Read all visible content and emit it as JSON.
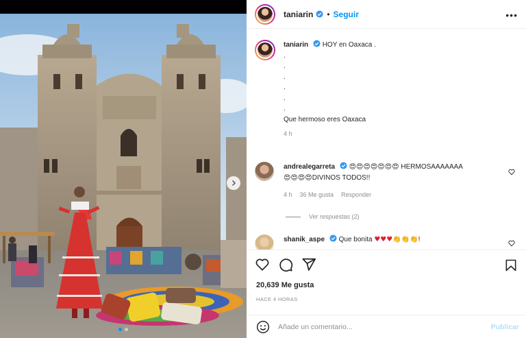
{
  "post": {
    "author": "taniarin",
    "follow_label": "Seguir",
    "separator": "•",
    "more_label": "•••",
    "caption": {
      "username": "taniarin",
      "text": "HOY en Oaxaca .",
      "dots": [
        ".",
        ".",
        ".",
        ".",
        ".",
        "."
      ],
      "last_line": "Que hermoso eres Oaxaca",
      "time": "4 h"
    },
    "likes": "20,639 Me gusta",
    "posted_ago": "HACE 4 HORAS"
  },
  "comments": [
    {
      "username": "andrealegarreta",
      "text_line1_emojis": "😍😍😍😍😍😍😍",
      "text_line1_word": " HERMOSAAAAAAA",
      "text_line2_emojis": "😍😍😍😍",
      "text_line2_word": "DIVINOS TODOS!!",
      "time": "4 h",
      "likes": "36 Me gusta",
      "reply_label": "Responder",
      "view_replies": "Ver respuestas (2)"
    },
    {
      "username": "shanik_aspe",
      "text": "Que bonita ",
      "emojis_hearts": "♥♥♥",
      "emojis_hands": "👏👏👏",
      "trailing": "!"
    }
  ],
  "composer": {
    "placeholder": "Añade un comentario...",
    "publish_label": "Publicar"
  },
  "carousel": {
    "slide_count": 2,
    "active_index": 0
  },
  "colors": {
    "accent": "#0095f6",
    "verified": "#3897f0",
    "muted": "#8e8e8e",
    "publish_disabled": "#b2dffc"
  },
  "icons": [
    "verified-icon",
    "more-icon",
    "heart-icon",
    "comment-icon",
    "share-icon",
    "bookmark-icon",
    "emoji-icon",
    "chevron-right-icon"
  ]
}
